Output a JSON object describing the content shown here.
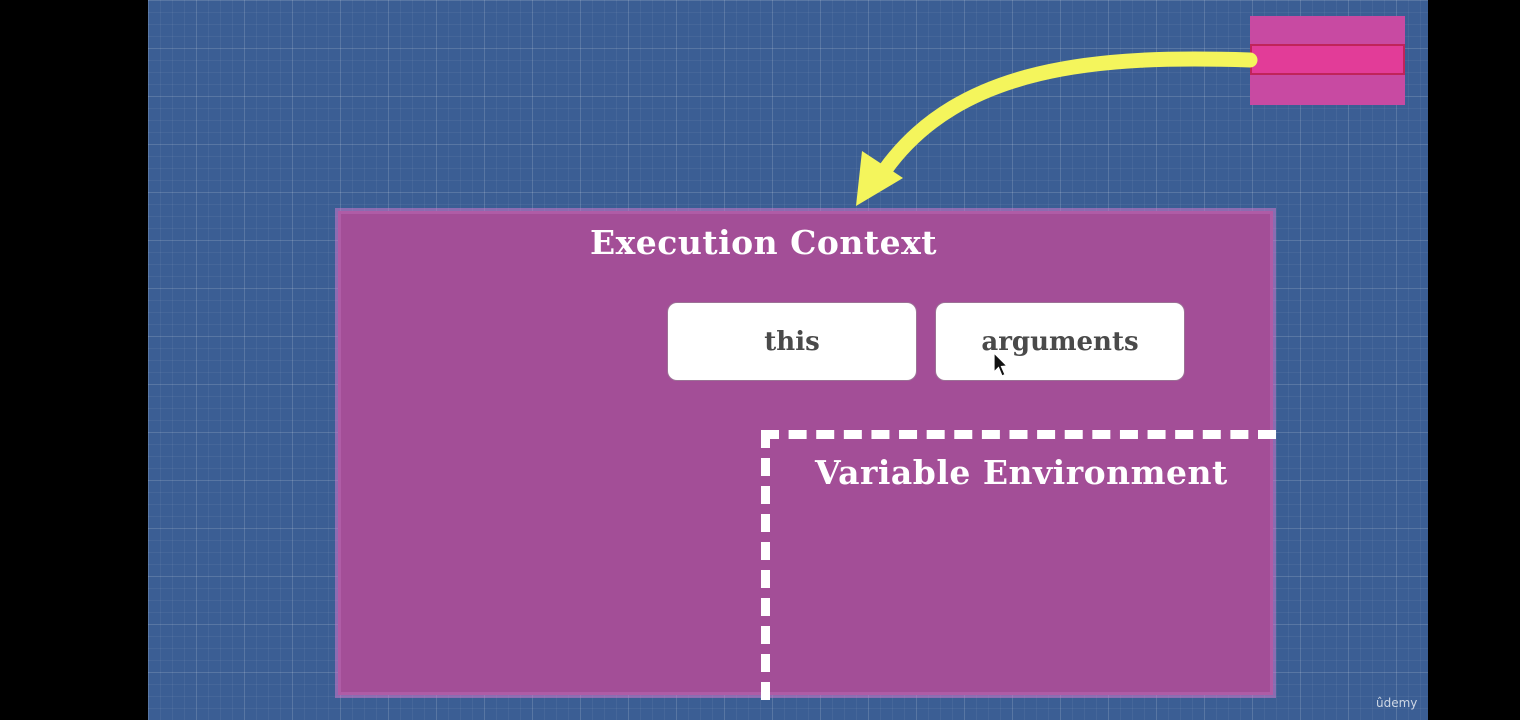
{
  "diagram": {
    "execution_context_label": "Execution Context",
    "this_label": "this",
    "arguments_label": "arguments",
    "variable_environment_label": "Variable Environment"
  },
  "watermark": "ûdemy",
  "colors": {
    "background": "#3b5e94",
    "execution_context_fill": "#a34e97",
    "stack_fill": "#c84aa2",
    "stack_active_frame": "#e23c98",
    "arrow": "#f4f55c",
    "pill_fill": "#ffffff",
    "pill_text": "#4a4a4a"
  }
}
